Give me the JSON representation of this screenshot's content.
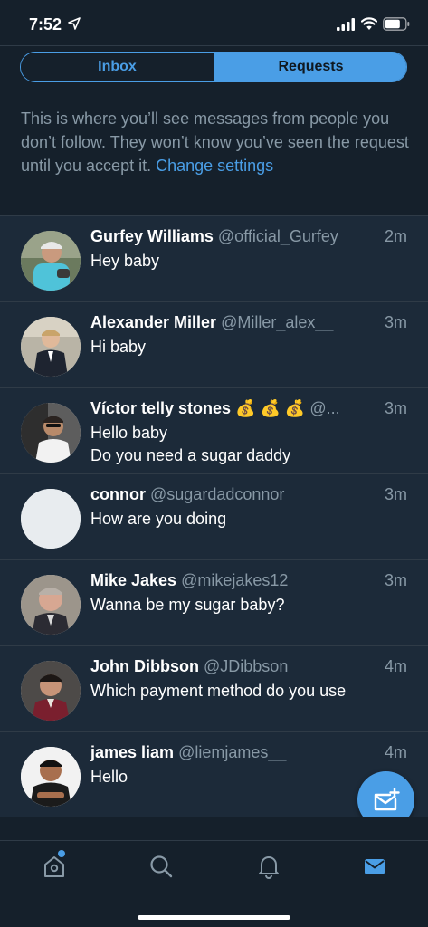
{
  "status_bar": {
    "time": "7:52",
    "icons": [
      "location-arrow-icon",
      "cellular-signal-icon",
      "wifi-icon",
      "battery-icon"
    ]
  },
  "tabs": {
    "inbox_label": "Inbox",
    "requests_label": "Requests",
    "selected": "Requests"
  },
  "info": {
    "text": "This is where you’ll see messages from people you don’t follow. They won’t know you’ve seen the request until you accept it. ",
    "link_label": "Change settings"
  },
  "requests": [
    {
      "name": "Gurfey Williams",
      "handle": "@official_Gurfey",
      "time": "2m",
      "message": "Hey baby"
    },
    {
      "name": "Alexander Miller",
      "handle": "@Miller_alex__",
      "time": "3m",
      "message": "Hi baby"
    },
    {
      "name": "Víctor telly stones 💰 💰 💰",
      "handle": "@...",
      "time": "3m",
      "message": "Hello baby\nDo you need a sugar daddy"
    },
    {
      "name": "connor",
      "handle": "@sugardadconnor",
      "time": "3m",
      "message": "How are you doing"
    },
    {
      "name": "Mike Jakes",
      "handle": "@mikejakes12",
      "time": "3m",
      "message": "Wanna be my sugar baby?"
    },
    {
      "name": "John Dibbson",
      "handle": "@JDibbson",
      "time": "4m",
      "message": "Which payment method do you use"
    },
    {
      "name": "james liam",
      "handle": "@liemjames__",
      "time": "4m",
      "message": "Hello"
    }
  ],
  "bottom_nav": {
    "items": [
      "home-icon",
      "search-icon",
      "notifications-icon",
      "messages-icon"
    ],
    "active": "messages-icon"
  },
  "colors": {
    "background": "#15202b",
    "row_background": "#1c2a39",
    "accent": "#4a9ee6",
    "secondary_text": "#8899a6"
  }
}
